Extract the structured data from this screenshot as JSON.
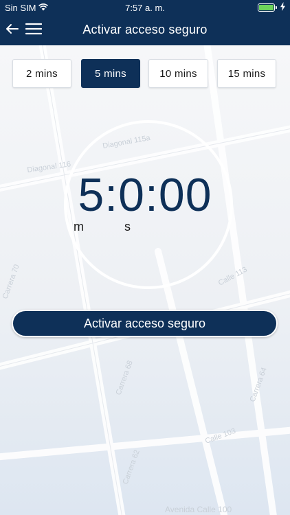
{
  "status_bar": {
    "carrier": "Sin SIM",
    "time": "7:57 a. m."
  },
  "header": {
    "title": "Activar acceso seguro"
  },
  "durations": [
    "2 mins",
    "5 mins",
    "10 mins",
    "15 mins"
  ],
  "selected_duration": "5 mins",
  "timer": {
    "display": "5:0:00",
    "minutes_label": "m",
    "seconds_label": "s"
  },
  "action_button": {
    "label": "Activar acceso seguro"
  },
  "map_labels": [
    "Diagonal 115a",
    "Diagonal 116",
    "Calle 113",
    "Carrera 70",
    "Carrera 68",
    "Calle 103",
    "Avenida Calle 100",
    "Carrera 64",
    "Carrera 62"
  ],
  "colors": {
    "primary": "#0e3058",
    "battery": "#6dd35b"
  }
}
